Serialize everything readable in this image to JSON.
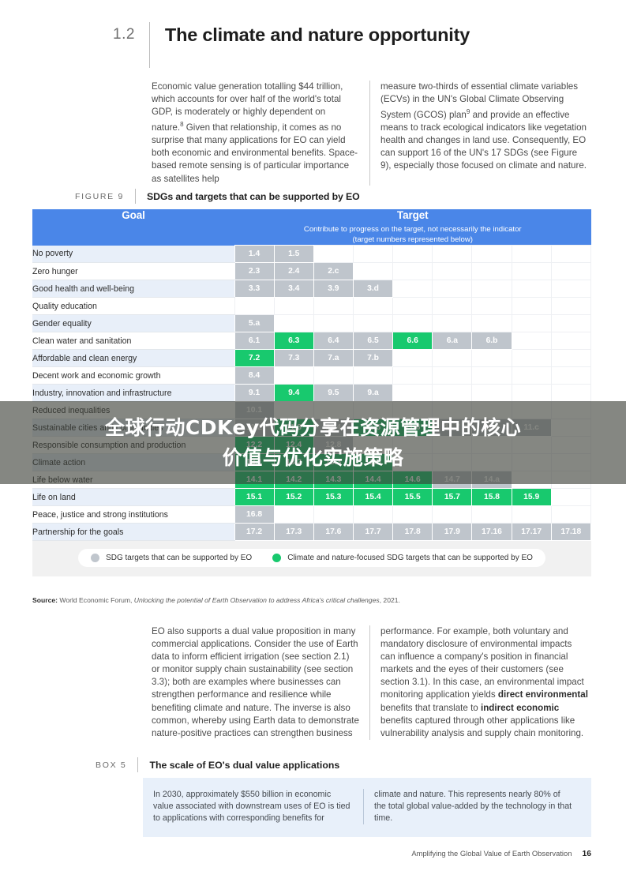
{
  "section": {
    "number": "1.2",
    "title": "The climate and nature opportunity"
  },
  "body_top": {
    "left": "Economic value generation totalling $44 trillion, which accounts for over half of the world's total GDP, is moderately or highly dependent on nature.",
    "left_footnote": "8",
    "left_cont": " Given that relationship, it comes as no surprise that many applications for EO can yield both economic and environmental benefits. Space-based remote sensing is of particular importance as satellites help",
    "right": "measure two-thirds of essential climate variables (ECVs) in the UN's Global Climate Observing System (GCOS) plan",
    "right_footnote": "9",
    "right_cont": " and provide an effective means to track ecological indicators like vegetation health and changes in land use. Consequently, EO can support 16 of the UN's 17 SDGs (see Figure 9), especially those focused on climate and nature."
  },
  "figure": {
    "label": "FIGURE 9",
    "title": "SDGs and targets that can be supported by EO",
    "header": {
      "goal": "Goal",
      "target": "Target",
      "target_sub_line1": "Contribute to progress on the target, not necessarily the indicator",
      "target_sub_line2": "(target numbers represented below)"
    },
    "legend": [
      {
        "color": "#c0c6cd",
        "label": "SDG targets that can be supported by EO"
      },
      {
        "color": "#18c96e",
        "label": "Climate and nature-focused SDG targets that can be supported by EO"
      }
    ],
    "source_prefix": "Source:",
    "source_org": " World Economic Forum, ",
    "source_title": "Unlocking the potential of Earth Observation to address Africa's critical challenges",
    "source_year": ", 2021.",
    "columns": 9,
    "rows": [
      {
        "goal": "No poverty",
        "targets": [
          {
            "v": "1.4",
            "s": "grey"
          },
          {
            "v": "1.5",
            "s": "grey"
          }
        ]
      },
      {
        "goal": "Zero hunger",
        "targets": [
          {
            "v": "2.3",
            "s": "grey"
          },
          {
            "v": "2.4",
            "s": "grey"
          },
          {
            "v": "2.c",
            "s": "grey"
          }
        ]
      },
      {
        "goal": "Good health and well-being",
        "targets": [
          {
            "v": "3.3",
            "s": "grey"
          },
          {
            "v": "3.4",
            "s": "grey"
          },
          {
            "v": "3.9",
            "s": "grey"
          },
          {
            "v": "3.d",
            "s": "grey"
          }
        ]
      },
      {
        "goal": "Quality education",
        "targets": []
      },
      {
        "goal": "Gender equality",
        "targets": [
          {
            "v": "5.a",
            "s": "grey"
          }
        ]
      },
      {
        "goal": "Clean water and sanitation",
        "targets": [
          {
            "v": "6.1",
            "s": "grey"
          },
          {
            "v": "6.3",
            "s": "green"
          },
          {
            "v": "6.4",
            "s": "grey"
          },
          {
            "v": "6.5",
            "s": "grey"
          },
          {
            "v": "6.6",
            "s": "green"
          },
          {
            "v": "6.a",
            "s": "grey"
          },
          {
            "v": "6.b",
            "s": "grey"
          }
        ]
      },
      {
        "goal": "Affordable and clean energy",
        "targets": [
          {
            "v": "7.2",
            "s": "green"
          },
          {
            "v": "7.3",
            "s": "grey"
          },
          {
            "v": "7.a",
            "s": "grey"
          },
          {
            "v": "7.b",
            "s": "grey"
          }
        ]
      },
      {
        "goal": "Decent work and economic growth",
        "targets": [
          {
            "v": "8.4",
            "s": "grey"
          }
        ]
      },
      {
        "goal": "Industry, innovation and infrastructure",
        "targets": [
          {
            "v": "9.1",
            "s": "grey"
          },
          {
            "v": "9.4",
            "s": "green"
          },
          {
            "v": "9.5",
            "s": "grey"
          },
          {
            "v": "9.a",
            "s": "grey"
          }
        ]
      },
      {
        "goal": "Reduced inequalities",
        "targets": [
          {
            "v": "10.1",
            "s": "grey"
          }
        ]
      },
      {
        "goal": "Sustainable cities and communities",
        "targets": [
          {
            "v": "11.2",
            "s": "grey"
          },
          {
            "v": "11.3",
            "s": "green"
          },
          {
            "v": "11.4",
            "s": "grey"
          },
          {
            "v": "11.5",
            "s": "green"
          },
          {
            "v": "11.6",
            "s": "green"
          },
          {
            "v": "11.7",
            "s": "grey"
          },
          {
            "v": "11.b",
            "s": "grey"
          },
          {
            "v": "11.c",
            "s": "grey"
          }
        ]
      },
      {
        "goal": "Responsible consumption and production",
        "targets": [
          {
            "v": "12.2",
            "s": "green"
          },
          {
            "v": "12.4",
            "s": "green"
          },
          {
            "v": "12.8",
            "s": "grey"
          }
        ]
      },
      {
        "goal": "Climate action",
        "targets": [
          {
            "v": "13.1",
            "s": "green"
          },
          {
            "v": "13.2",
            "s": "green"
          },
          {
            "v": "13.3",
            "s": "green"
          },
          {
            "v": "13.b",
            "s": "green"
          }
        ]
      },
      {
        "goal": "Life below water",
        "targets": [
          {
            "v": "14.1",
            "s": "green"
          },
          {
            "v": "14.2",
            "s": "green"
          },
          {
            "v": "14.3",
            "s": "green"
          },
          {
            "v": "14.4",
            "s": "green"
          },
          {
            "v": "14.6",
            "s": "green"
          },
          {
            "v": "14.7",
            "s": "grey"
          },
          {
            "v": "14.a",
            "s": "grey"
          }
        ]
      },
      {
        "goal": "Life on land",
        "targets": [
          {
            "v": "15.1",
            "s": "green"
          },
          {
            "v": "15.2",
            "s": "green"
          },
          {
            "v": "15.3",
            "s": "green"
          },
          {
            "v": "15.4",
            "s": "green"
          },
          {
            "v": "15.5",
            "s": "green"
          },
          {
            "v": "15.7",
            "s": "green"
          },
          {
            "v": "15.8",
            "s": "green"
          },
          {
            "v": "15.9",
            "s": "green"
          }
        ]
      },
      {
        "goal": "Peace, justice and strong institutions",
        "targets": [
          {
            "v": "16.8",
            "s": "grey"
          }
        ]
      },
      {
        "goal": "Partnership for the goals",
        "targets": [
          {
            "v": "17.2",
            "s": "grey"
          },
          {
            "v": "17.3",
            "s": "grey"
          },
          {
            "v": "17.6",
            "s": "grey"
          },
          {
            "v": "17.7",
            "s": "grey"
          },
          {
            "v": "17.8",
            "s": "grey"
          },
          {
            "v": "17.9",
            "s": "grey"
          },
          {
            "v": "17.16",
            "s": "grey"
          },
          {
            "v": "17.17",
            "s": "grey"
          },
          {
            "v": "17.18",
            "s": "grey"
          }
        ]
      }
    ]
  },
  "body_bottom": {
    "left": "EO also supports a dual value proposition in many commercial applications. Consider the use of Earth data to inform efficient irrigation (see section 2.1) or monitor supply chain sustainability (see section 3.3); both are examples where businesses can strengthen performance and resilience while benefiting climate and nature. The inverse is also common, whereby using Earth data to demonstrate nature-positive practices can strengthen business",
    "right_part1": "performance. For example, both voluntary and mandatory disclosure of environmental impacts can influence a company's position in financial markets and the eyes of their customers (see section 3.1). In this case, an environmental impact monitoring application yields ",
    "right_bold1": "direct environmental",
    "right_part2": " benefits that translate to ",
    "right_bold2": "indirect economic",
    "right_part3": " benefits captured through other applications like vulnerability analysis and supply chain monitoring."
  },
  "box": {
    "label": "BOX 5",
    "title": "The scale of EO's dual value applications",
    "left": "In 2030, approximately $550 billion in economic value associated with downstream uses of EO is tied to applications with corresponding benefits for",
    "right": "climate and nature. This represents nearly 80% of the total global value-added by the technology in that time."
  },
  "footer": {
    "text": "Amplifying the Global Value of Earth Observation",
    "page": "16"
  },
  "overlay": {
    "line1": "全球行动CDKey代码分享在资源管理中的核心",
    "line2": "价值与优化实施策略"
  },
  "colors": {
    "header_blue": "#4a86e8",
    "target_grey": "#bfc5cc",
    "target_green": "#18c96e",
    "row_alt": "#e8eff9",
    "box_bg": "#e8f0fa"
  }
}
